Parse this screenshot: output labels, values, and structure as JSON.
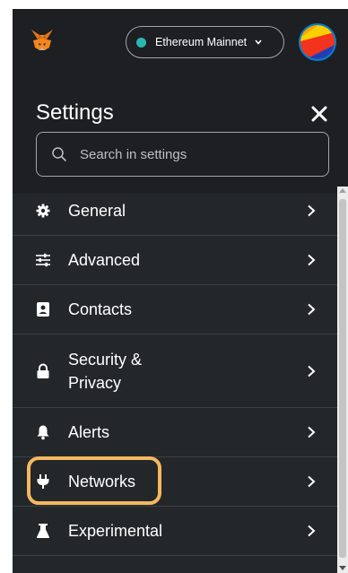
{
  "header": {
    "network": {
      "label": "Ethereum Mainnet",
      "status_color": "#29b6af"
    }
  },
  "settings": {
    "title": "Settings",
    "close_icon": "close-icon",
    "search": {
      "placeholder": "Search in settings",
      "value": ""
    }
  },
  "items": [
    {
      "label": "General",
      "icon": "gear-icon"
    },
    {
      "label": "Advanced",
      "icon": "sliders-icon"
    },
    {
      "label": "Contacts",
      "icon": "contact-card-icon"
    },
    {
      "label": "Security & Privacy",
      "icon": "lock-icon"
    },
    {
      "label": "Alerts",
      "icon": "bell-icon"
    },
    {
      "label": "Networks",
      "icon": "plug-icon"
    },
    {
      "label": "Experimental",
      "icon": "flask-icon"
    }
  ],
  "colors": {
    "background": "#24272a",
    "header": "#1d1f22",
    "highlight": "#f4b860",
    "account_border": "#037dd6"
  }
}
